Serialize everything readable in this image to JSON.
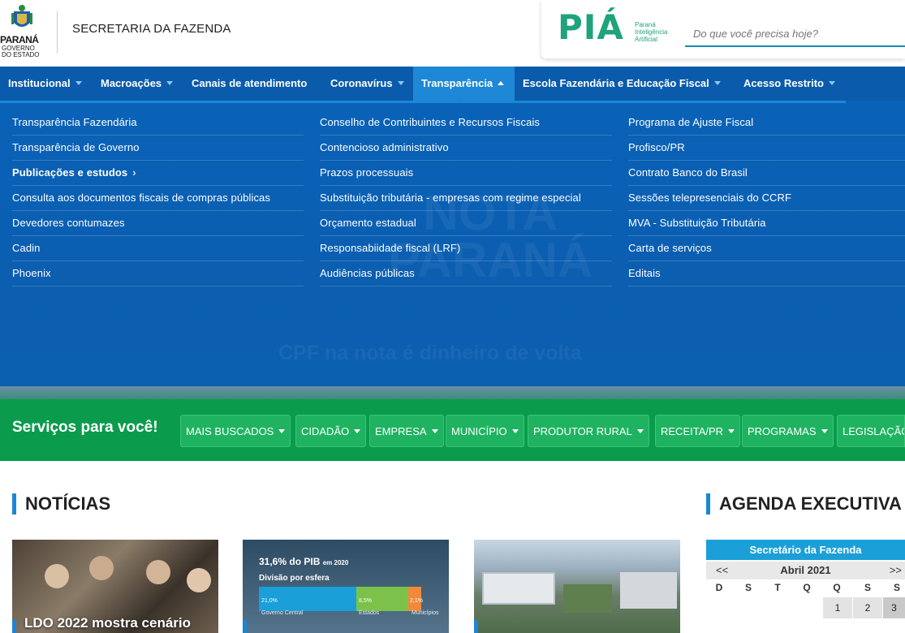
{
  "header": {
    "logo_word": "PARANÁ",
    "logo_sub_line1": "GOVERNO",
    "logo_sub_line2": "DO ESTADO",
    "site_title": "SECRETARIA DA FAZENDA",
    "pia_logo": "PIÁ",
    "pia_tag_line1": "Paraná",
    "pia_tag_line2": "Inteligência",
    "pia_tag_line3": "Artificial",
    "search_placeholder": "Do que você precisa hoje?"
  },
  "nav": {
    "items": [
      {
        "label": "Institucional"
      },
      {
        "label": "Macroações"
      },
      {
        "label": "Canais de atendimento"
      },
      {
        "label": "Coronavírus"
      },
      {
        "label": "Transparência"
      },
      {
        "label": "Escola Fazendária e Educação Fiscal"
      },
      {
        "label": "Acesso Restrito"
      }
    ]
  },
  "mega_menu": {
    "columns": [
      {
        "items": [
          {
            "label": "Transparência Fazendária"
          },
          {
            "label": "Transparência de Governo"
          },
          {
            "label": "Publicações e estudos"
          },
          {
            "label": "Consulta aos documentos fiscais de compras públicas"
          },
          {
            "label": "Devedores contumazes"
          },
          {
            "label": "Cadin"
          },
          {
            "label": "Phoenix"
          }
        ]
      },
      {
        "items": [
          {
            "label": "Conselho de Contribuintes e Recursos Fiscais"
          },
          {
            "label": "Contencioso administrativo"
          },
          {
            "label": "Prazos processuais"
          },
          {
            "label": "Substituição tributária - empresas com regime especial"
          },
          {
            "label": "Orçamento estadual"
          },
          {
            "label": "Responsabiidade fiscal (LRF)"
          },
          {
            "label": "Audiências públicas"
          }
        ]
      },
      {
        "items": [
          {
            "label": "Programa de Ajuste Fiscal"
          },
          {
            "label": "Profisco/PR"
          },
          {
            "label": "Contrato Banco do Brasil"
          },
          {
            "label": "Sessões telepresenciais do CCRF"
          },
          {
            "label": "MVA - Substituição Tributária"
          },
          {
            "label": "Carta de serviços"
          },
          {
            "label": "Editais"
          }
        ]
      }
    ],
    "banner_text": "CPF na nota é dinheiro de volta",
    "banner_logo_line1": "NOTA",
    "banner_logo_line2": "PARANÁ"
  },
  "services": {
    "title": "Serviços para você!",
    "buttons": [
      {
        "label": "MAIS BUSCADOS"
      },
      {
        "label": "CIDADÃO"
      },
      {
        "label": "EMPRESA"
      },
      {
        "label": "MUNICÍPIO"
      },
      {
        "label": "PRODUTOR RURAL"
      },
      {
        "label": "RECEITA/PR"
      },
      {
        "label": "PROGRAMAS"
      },
      {
        "label": "LEGISLAÇÃO"
      }
    ]
  },
  "news": {
    "title": "NOTÍCIAS",
    "cards": [
      {
        "caption": "LDO 2022 mostra cenário"
      },
      {
        "caption": ""
      },
      {
        "caption": ""
      }
    ],
    "pib": {
      "title": "31,6% do PIB",
      "title_small": "em 2020",
      "subtitle": "Divisão por esfera",
      "segments": [
        {
          "label": "Governo Central",
          "value": "21,0%",
          "color": "#1b9fd8"
        },
        {
          "label": "Estados",
          "value": "8,5%",
          "color": "#7cc24a"
        },
        {
          "label": "Municípios",
          "value": "2,1%",
          "color": "#f08a3a"
        }
      ]
    }
  },
  "agenda": {
    "title": "AGENDA EXECUTIVA",
    "owner": "Secretário da Fazenda",
    "prev": "<<",
    "month": "Abril 2021",
    "next": ">>",
    "weekdays": [
      "D",
      "S",
      "T",
      "Q",
      "Q",
      "S",
      "S"
    ],
    "days": [
      "1",
      "2",
      "3"
    ]
  }
}
